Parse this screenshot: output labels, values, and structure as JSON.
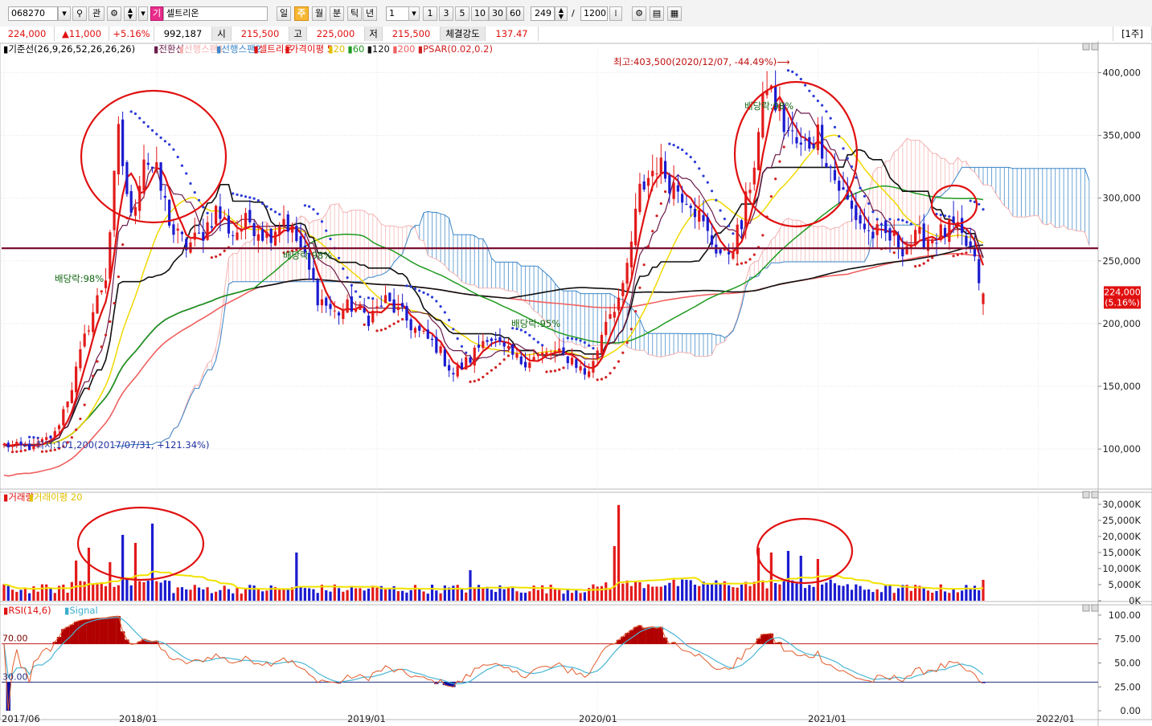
{
  "toolbar": {
    "code": "068270",
    "btn_gwan": "관",
    "stock_tag": "기",
    "stock_name": "셀트리온",
    "periods": [
      "일",
      "주",
      "월",
      "분",
      "틱",
      "년"
    ],
    "active_period": "주",
    "interval_value": "1",
    "interval_buttons": [
      "1",
      "3",
      "5",
      "10",
      "30",
      "60"
    ],
    "count_value": "249",
    "separator": "/",
    "total_value": "1200"
  },
  "quote": {
    "price": "224,000",
    "change": "▲11,000",
    "change_pct": "+5.16%",
    "volume": "992,187",
    "open_label": "시",
    "open": "215,500",
    "high_label": "고",
    "high": "225,000",
    "low_label": "저",
    "low": "215,500",
    "strength_label": "체결강도",
    "strength": "137.47",
    "period_badge": "[1주]"
  },
  "colors": {
    "up": "#e31a1a",
    "down": "#1b1bd0",
    "ma5": "#e01010",
    "ma20": "#f0d800",
    "ma60": "#1f9a1f",
    "ma120": "#111111",
    "ma200": "#f06060",
    "conversion": "#6b1a4a",
    "base": "#111111",
    "span1": "#f4b2b2",
    "span2": "#3a86c8",
    "psar": "#d02020",
    "price_line": "#7a1030"
  },
  "chart_data": [
    {
      "type": "candlestick",
      "legend": [
        {
          "text": "▮기준선(26,9,26,52,26,26,26)",
          "color": "#000000"
        },
        {
          "text": "▮전환선",
          "color": "#6b1a4a"
        },
        {
          "text": "▮선행스팬1",
          "color": "#f4b2b2"
        },
        {
          "text": "▮선행스팬2",
          "color": "#3a86c8"
        },
        {
          "text": "▮셀트리온",
          "color": "#e01010"
        },
        {
          "text": "▮가격이평 5",
          "color": "#e01010"
        },
        {
          "text": "▮20",
          "color": "#e0c000"
        },
        {
          "text": "▮60",
          "color": "#1f9a1f"
        },
        {
          "text": "▮120",
          "color": "#111111"
        },
        {
          "text": "▮200",
          "color": "#f06060"
        },
        {
          "text": "▮PSAR(0.02,0.2)",
          "color": "#d02020"
        }
      ],
      "yticks": [
        "100,000",
        "150,000",
        "200,000",
        "250,000",
        "300,000",
        "350,000",
        "400,000"
      ],
      "ytick_values": [
        100000,
        150000,
        200000,
        250000,
        300000,
        350000,
        400000
      ],
      "ylim": [
        70000,
        415000
      ],
      "xticks": [
        "2017/06",
        "2018/01",
        "2019/01",
        "2020/01",
        "2021/01",
        "2022/01"
      ],
      "last_price": "224,000",
      "last_change": "(5.16%)",
      "horizontal_line": 260000,
      "annotations": {
        "high": "최고:403,500(2020/12/07, -44.49%)⟶",
        "low": "⟵최저:101,200(2017/07/31, +121.34%)",
        "div1": "배당락:98%",
        "div2": "배당락:98%",
        "div3": "배당락:95%",
        "div4": "배당락:98%"
      },
      "anchors": [
        {
          "week": 0,
          "price": 103000
        },
        {
          "week": 7,
          "price": 101200
        },
        {
          "week": 12,
          "price": 112000
        },
        {
          "week": 16,
          "price": 150000
        },
        {
          "week": 20,
          "price": 200000
        },
        {
          "week": 24,
          "price": 238000
        },
        {
          "week": 27,
          "price": 350000
        },
        {
          "week": 30,
          "price": 282000
        },
        {
          "week": 33,
          "price": 335000
        },
        {
          "week": 36,
          "price": 318000
        },
        {
          "week": 40,
          "price": 272000
        },
        {
          "week": 43,
          "price": 262000
        },
        {
          "week": 46,
          "price": 268000
        },
        {
          "week": 50,
          "price": 290000
        },
        {
          "week": 54,
          "price": 272000
        },
        {
          "week": 58,
          "price": 282000
        },
        {
          "week": 62,
          "price": 270000
        },
        {
          "week": 66,
          "price": 285000
        },
        {
          "week": 70,
          "price": 260000
        },
        {
          "week": 74,
          "price": 222000
        },
        {
          "week": 78,
          "price": 208000
        },
        {
          "week": 82,
          "price": 214000
        },
        {
          "week": 86,
          "price": 205000
        },
        {
          "week": 90,
          "price": 218000
        },
        {
          "week": 94,
          "price": 206000
        },
        {
          "week": 98,
          "price": 192000
        },
        {
          "week": 102,
          "price": 182000
        },
        {
          "week": 106,
          "price": 160000
        },
        {
          "week": 110,
          "price": 172000
        },
        {
          "week": 114,
          "price": 192000
        },
        {
          "week": 118,
          "price": 178000
        },
        {
          "week": 122,
          "price": 170000
        },
        {
          "week": 126,
          "price": 174000
        },
        {
          "week": 130,
          "price": 176000
        },
        {
          "week": 134,
          "price": 172000
        },
        {
          "week": 137,
          "price": 160000
        },
        {
          "week": 139,
          "price": 168000
        },
        {
          "week": 142,
          "price": 205000
        },
        {
          "week": 146,
          "price": 225000
        },
        {
          "week": 150,
          "price": 305000
        },
        {
          "week": 154,
          "price": 328000
        },
        {
          "week": 158,
          "price": 310000
        },
        {
          "week": 162,
          "price": 300000
        },
        {
          "week": 166,
          "price": 270000
        },
        {
          "week": 170,
          "price": 252000
        },
        {
          "week": 174,
          "price": 278000
        },
        {
          "week": 177,
          "price": 330000
        },
        {
          "week": 180,
          "price": 392000
        },
        {
          "week": 184,
          "price": 358000
        },
        {
          "week": 188,
          "price": 338000
        },
        {
          "week": 192,
          "price": 352000
        },
        {
          "week": 196,
          "price": 315000
        },
        {
          "week": 200,
          "price": 290000
        },
        {
          "week": 204,
          "price": 272000
        },
        {
          "week": 208,
          "price": 270000
        },
        {
          "week": 212,
          "price": 262000
        },
        {
          "week": 216,
          "price": 268000
        },
        {
          "week": 220,
          "price": 270000
        },
        {
          "week": 224,
          "price": 276000
        },
        {
          "week": 228,
          "price": 258000
        },
        {
          "week": 231,
          "price": 224000
        }
      ]
    },
    {
      "type": "bar",
      "legend": [
        {
          "text": "▮거래량",
          "color": "#e01010"
        },
        {
          "text": "▮거래이평 20",
          "color": "#e0c000"
        }
      ],
      "yticks": [
        "0K",
        "5,000K",
        "10,000K",
        "15,000K",
        "20,000K",
        "25,000K",
        "30,000K"
      ],
      "ytick_values": [
        0,
        5000,
        10000,
        15000,
        20000,
        25000,
        30000
      ],
      "ylim": [
        0,
        31500
      ],
      "volume_spikes": [
        {
          "week": 17,
          "value": 12500
        },
        {
          "week": 20,
          "value": 16500
        },
        {
          "week": 25,
          "value": 12000
        },
        {
          "week": 28,
          "value": 20500
        },
        {
          "week": 31,
          "value": 18000
        },
        {
          "week": 35,
          "value": 24000
        },
        {
          "week": 69,
          "value": 15000
        },
        {
          "week": 110,
          "value": 9500
        },
        {
          "week": 144,
          "value": 17000
        },
        {
          "week": 145,
          "value": 29800
        },
        {
          "week": 178,
          "value": 16500
        },
        {
          "week": 181,
          "value": 15000
        },
        {
          "week": 185,
          "value": 15500
        },
        {
          "week": 188,
          "value": 14000
        },
        {
          "week": 192,
          "value": 13000
        },
        {
          "week": 231,
          "value": 6500
        }
      ]
    },
    {
      "type": "line",
      "legend": [
        {
          "text": "▮RSI(14,6)",
          "color": "#e01010"
        },
        {
          "text": "▮Signal",
          "color": "#3aaccc"
        }
      ],
      "yticks": [
        "0.00",
        "25.00",
        "50.00",
        "75.00",
        "100.00"
      ],
      "ytick_values": [
        0,
        25,
        50,
        75,
        100
      ],
      "ylim": [
        -5,
        105
      ],
      "upper_line": 70,
      "lower_line": 30,
      "lower_label": "30.00",
      "upper_label": "70.00"
    }
  ]
}
